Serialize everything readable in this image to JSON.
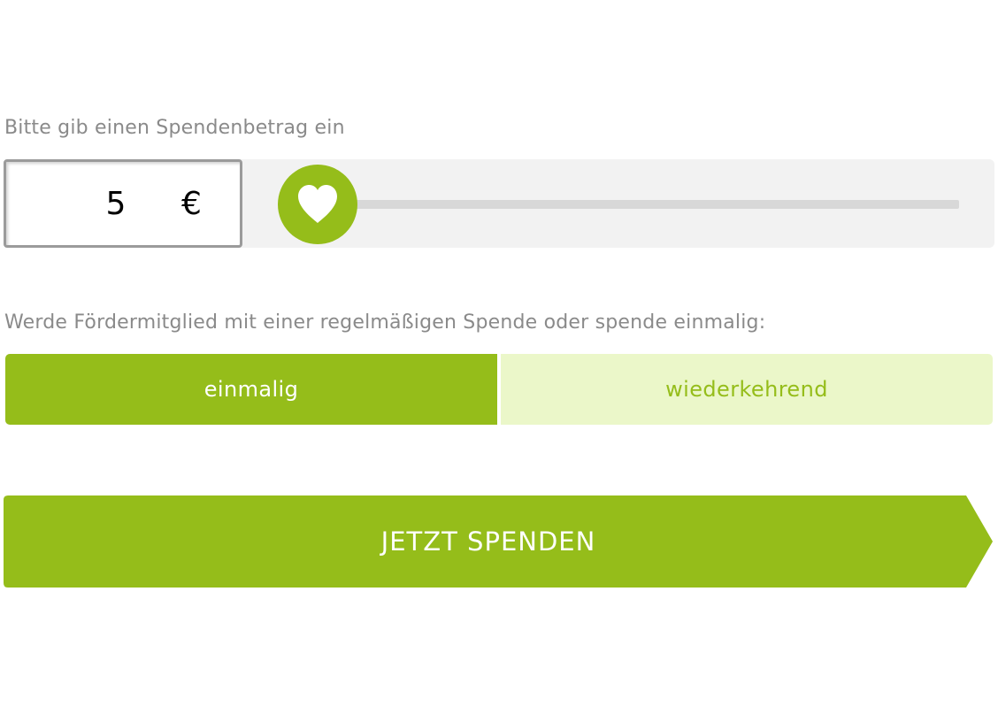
{
  "amount": {
    "label": "Bitte gib einen Spendenbetrag ein",
    "value": "5",
    "currency": "€"
  },
  "slider": {
    "thumb_icon": "heart-icon"
  },
  "interval": {
    "label": "Werde Fördermitglied mit einer regelmäßigen Spende oder spende einmalig:",
    "options": [
      {
        "label": "einmalig",
        "selected": true
      },
      {
        "label": "wiederkehrend",
        "selected": false
      }
    ]
  },
  "cta": {
    "label": "JETZT SPENDEN"
  },
  "colors": {
    "accent": "#95bd1a",
    "accent_light": "#ebf7c9",
    "label_gray": "#8a8a8a",
    "panel_bg": "#f2f2f2",
    "track": "#d8d8d8"
  }
}
